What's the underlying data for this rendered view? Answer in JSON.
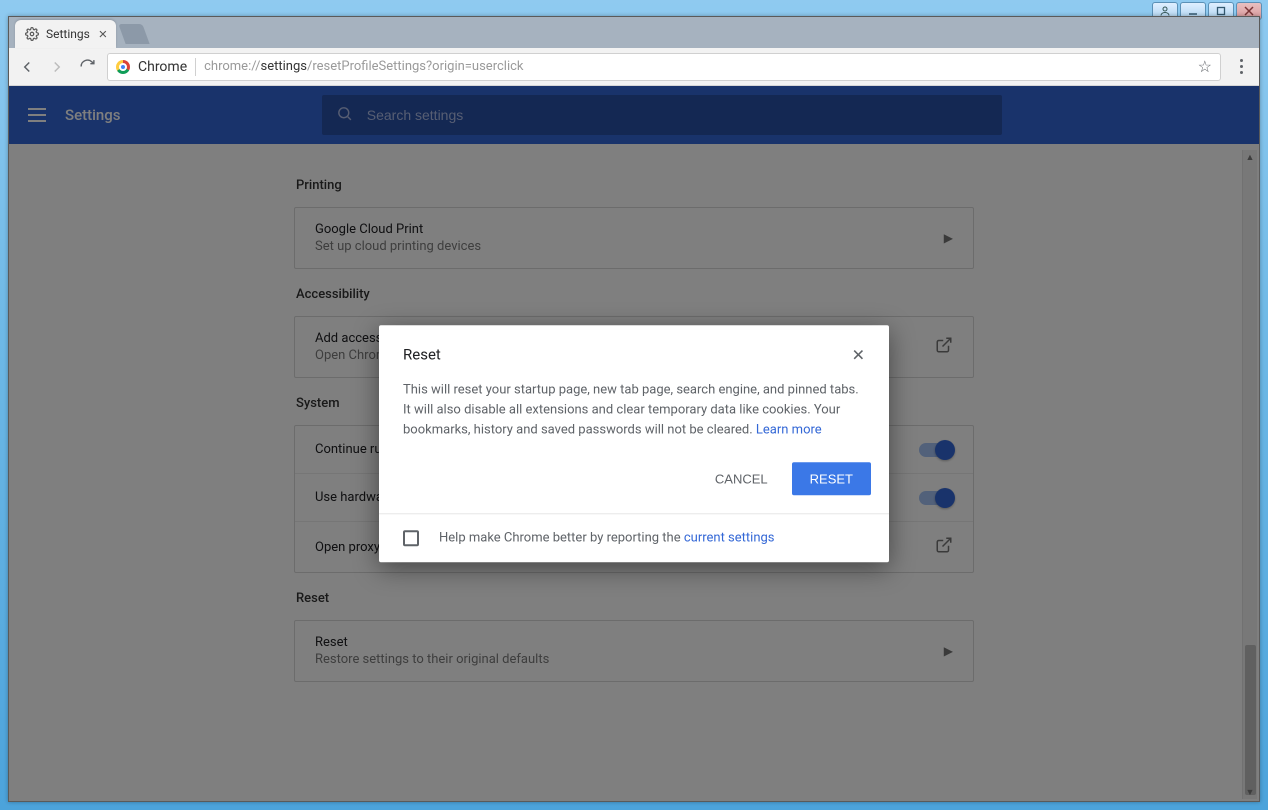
{
  "window": {
    "tab_title": "Settings",
    "omnibox_label": "Chrome",
    "url_prefix": "chrome://",
    "url_bold": "settings",
    "url_tail": "/resetProfileSettings?origin=userclick"
  },
  "md_header": {
    "title": "Settings",
    "search_placeholder": "Search settings"
  },
  "sections": {
    "printing": {
      "title": "Printing",
      "item_title": "Google Cloud Print",
      "item_sub": "Set up cloud printing devices"
    },
    "accessibility": {
      "title": "Accessibility",
      "item_title": "Add accessibility features",
      "item_sub": "Open Chrome Web Store"
    },
    "system": {
      "title": "System",
      "row1": "Continue running background apps when Google Chrome is closed",
      "row2": "Use hardware acceleration when available",
      "row3": "Open proxy settings"
    },
    "reset": {
      "title": "Reset",
      "item_title": "Reset",
      "item_sub": "Restore settings to their original defaults"
    }
  },
  "dialog": {
    "title": "Reset",
    "body": "This will reset your startup page, new tab page, search engine, and pinned tabs. It will also disable all extensions and clear temporary data like cookies. Your bookmarks, history and saved passwords will not be cleared. ",
    "learn_more": "Learn more",
    "cancel": "Cancel",
    "reset": "Reset",
    "footer_text": "Help make Chrome better by reporting the ",
    "footer_link": "current settings"
  }
}
